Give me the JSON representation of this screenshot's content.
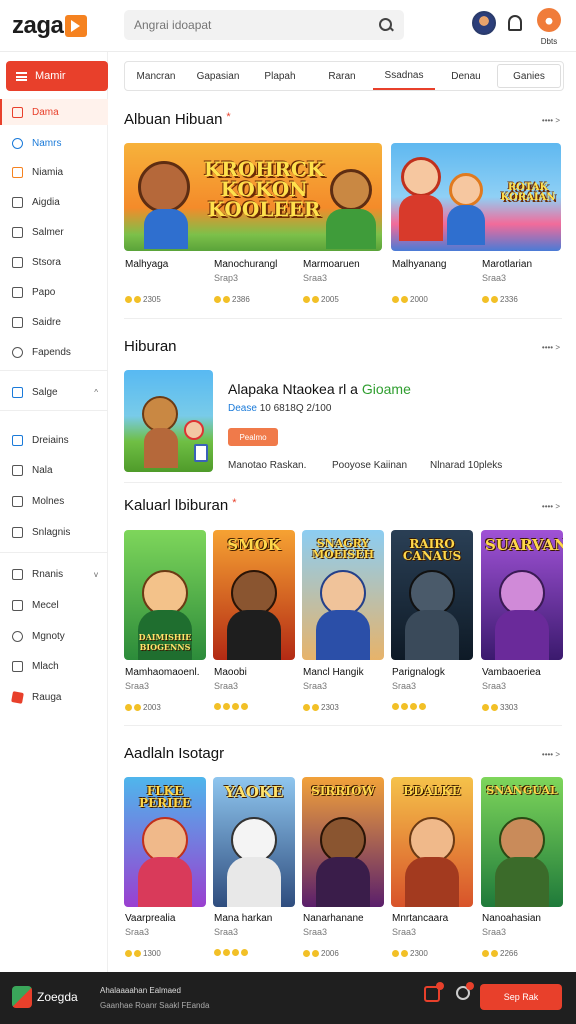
{
  "header": {
    "logo": "zaga",
    "search_placeholder": "Angrai idoapat",
    "user_label": "Dbts"
  },
  "sidebar": {
    "menu_label": "Mamir",
    "items": [
      {
        "label": "Dama",
        "icon": "home-icon",
        "state": "active"
      },
      {
        "label": "Namrs",
        "icon": "globe-icon",
        "state": "blue"
      },
      {
        "label": "Niamia",
        "icon": "grid-icon"
      },
      {
        "label": "Aigdia",
        "icon": "pin-icon"
      },
      {
        "label": "Salmer",
        "icon": "chart-icon"
      },
      {
        "label": "Stsora",
        "icon": "folder-icon"
      },
      {
        "label": "Papo",
        "icon": "page-icon"
      },
      {
        "label": "Saidre",
        "icon": "people-icon"
      },
      {
        "label": "Fapends",
        "icon": "clock-icon"
      },
      {
        "label": "Salge",
        "icon": "square-icon",
        "caret": "^"
      },
      {
        "label": "Dreiains",
        "icon": "share-icon"
      },
      {
        "label": "Nala",
        "icon": "doc-icon"
      },
      {
        "label": "Molnes",
        "icon": "book-icon"
      },
      {
        "label": "Snlagnis",
        "icon": "card-icon"
      },
      {
        "label": "Rnanis",
        "icon": "list-icon",
        "caret": "v"
      },
      {
        "label": "Mecel",
        "icon": "bag-icon"
      },
      {
        "label": "Mgnoty",
        "icon": "help-icon"
      },
      {
        "label": "Mlach",
        "icon": "box-icon"
      },
      {
        "label": "Rauga",
        "icon": "flag-icon"
      }
    ]
  },
  "tabs": [
    "Mancran",
    "Gapasian",
    "Plapah",
    "Raran",
    "Ssadnas",
    "Denau",
    "Ganies"
  ],
  "sections": {
    "s1": {
      "title": "Albuan Hibuan",
      "more": "•••• >"
    },
    "s2": {
      "title": "Hiburan",
      "more": "•••• >"
    },
    "s3": {
      "title": "Kaluarl lbiburan",
      "more": "•••• >"
    },
    "s4": {
      "title": "Aadlaln Isotagr",
      "more": "•••• >"
    }
  },
  "banners": [
    {
      "art_text": "KROHRCK KOKON KOOLEER"
    },
    {
      "art_text": "ROTAK KORAIAN"
    }
  ],
  "row1_cards": [
    {
      "title": "Malhyaga",
      "sub": "",
      "rating": "2305"
    },
    {
      "title": "Manochurangl",
      "sub": "Srap3",
      "rating": "2386"
    },
    {
      "title": "Marmoaruen",
      "sub": "Sraa3",
      "rating": "2005"
    },
    {
      "title": "Malhyanang",
      "sub": "",
      "rating": "2000"
    },
    {
      "title": "Marotlarian",
      "sub": "Sraa3",
      "rating": "2336"
    }
  ],
  "featured": {
    "title_main": "Alapaka Ntaokea rl a",
    "title_accent": "Gioame",
    "sub_accent": "Dease",
    "sub_rest": "10 6818Q 2/100",
    "tag": "Pealmo",
    "meta": [
      "Manotao Raskan.",
      "Pooyose Kaiinan",
      "Nlnarad 10pleks"
    ]
  },
  "row3_cards": [
    {
      "title": "Mamhaomaoenl.",
      "sub": "Sraa3",
      "rating": "2003",
      "art": "DAIMISHIE BIOGENNS"
    },
    {
      "title": "Maoobi",
      "sub": "Sraa3",
      "rating": "",
      "art": "SMOK"
    },
    {
      "title": "Mancl Hangik",
      "sub": "Sraa3",
      "rating": "2303",
      "art": "SNAGRY MOEISEH"
    },
    {
      "title": "Parignalogk",
      "sub": "Sraa3",
      "rating": "",
      "art": "RAIRO CANAUS"
    },
    {
      "title": "Vambaoeriea",
      "sub": "Sraa3",
      "rating": "3303",
      "art": "SUARVAN"
    }
  ],
  "row4_cards": [
    {
      "title": "Vaarprealia",
      "sub": "Sraa3",
      "rating": "1300",
      "art": "FLKE PERIEE"
    },
    {
      "title": "Mana harkan",
      "sub": "Sraa3",
      "rating": "",
      "art": "YAOKE"
    },
    {
      "title": "Nanarhanane",
      "sub": "Sraa3",
      "rating": "2006",
      "art": "SIRRIOW"
    },
    {
      "title": "Mnrtancaara",
      "sub": "Sraa3",
      "rating": "2300",
      "art": "BDALKE"
    },
    {
      "title": "Nanoahasian",
      "sub": "Sraa3",
      "rating": "2266",
      "art": "SNANGUAL"
    }
  ],
  "footer": {
    "brand": "Zoegda",
    "line1": "Ahalaaaahan   Ealmaed",
    "line2": "Gaanhae Roanr   Saakl FEanda",
    "cta": "Sep Rak"
  },
  "colors": {
    "accent": "#e8402b",
    "brand": "#f58220",
    "rating": "#f2c027",
    "link": "#1a7ad9"
  }
}
